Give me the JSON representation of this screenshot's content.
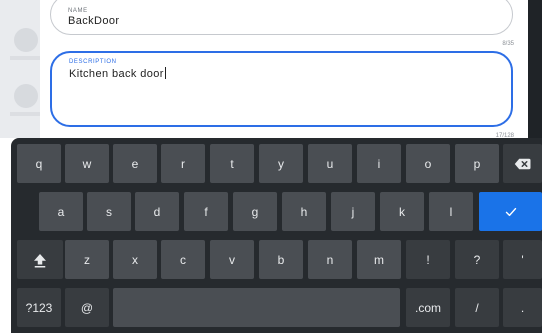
{
  "form": {
    "name": {
      "label": "NAME",
      "value": "BackDoor",
      "counter": "8/35"
    },
    "description": {
      "label": "DESCRIPTION",
      "value": "Kitchen back door",
      "counter": "17/128"
    }
  },
  "keyboard": {
    "row1": [
      "q",
      "w",
      "e",
      "r",
      "t",
      "y",
      "u",
      "i",
      "o",
      "p"
    ],
    "row2": [
      "a",
      "s",
      "d",
      "f",
      "g",
      "h",
      "j",
      "k",
      "l"
    ],
    "row3": [
      "z",
      "x",
      "c",
      "v",
      "b",
      "n",
      "m",
      "!",
      "?",
      "'"
    ],
    "row4": {
      "symbols": "?123",
      "at": "@",
      "dotcom": ".com",
      "slash": "/",
      "period": "."
    },
    "icons": {
      "backspace": "backspace-icon",
      "enter": "checkmark-icon",
      "shift": "shift-icon"
    },
    "accent": "#1a73e8"
  }
}
